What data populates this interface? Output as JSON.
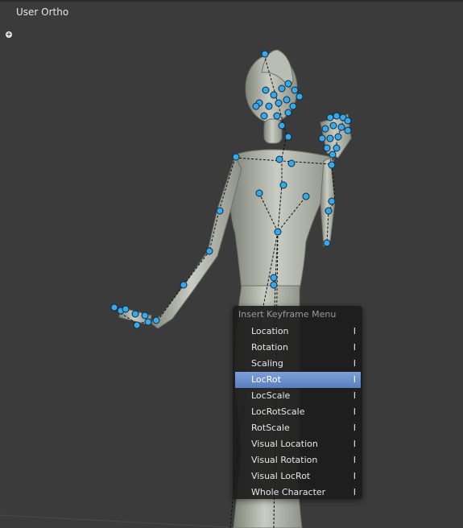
{
  "viewport": {
    "view_name": "User Ortho"
  },
  "menu": {
    "title": "Insert Keyframe Menu",
    "items": [
      {
        "label": "Location",
        "shortcut": "I"
      },
      {
        "label": "Rotation",
        "shortcut": "I"
      },
      {
        "label": "Scaling",
        "shortcut": "I"
      },
      {
        "label": "LocRot",
        "shortcut": "I"
      },
      {
        "label": "LocScale",
        "shortcut": "I"
      },
      {
        "label": "LocRotScale",
        "shortcut": "I"
      },
      {
        "label": "RotScale",
        "shortcut": "I"
      },
      {
        "label": "Visual Location",
        "shortcut": "I"
      },
      {
        "label": "Visual Rotation",
        "shortcut": "I"
      },
      {
        "label": "Visual LocRot",
        "shortcut": "I"
      },
      {
        "label": "Whole Character",
        "shortcut": "I"
      }
    ],
    "active_item": "LocRot"
  },
  "colors": {
    "background": "#3b3b3b",
    "highlight": "#5a7fc0",
    "bone_point": "#38a8e8"
  }
}
